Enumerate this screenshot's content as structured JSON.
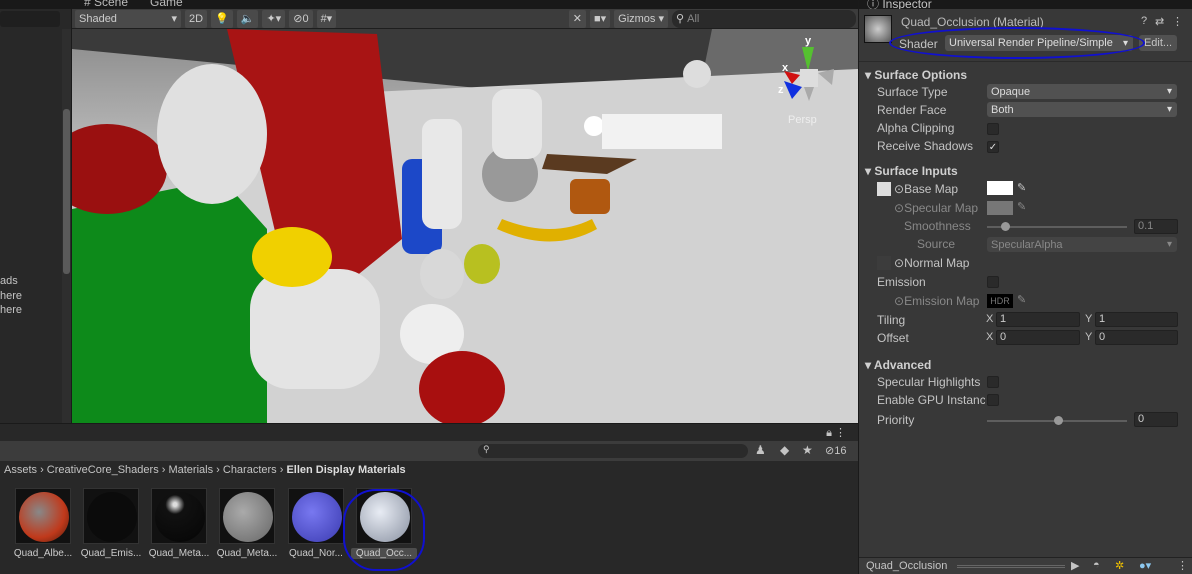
{
  "tabs": {
    "scene": "# Scene",
    "game": "Game"
  },
  "scene_toolbar": {
    "draw_mode": "Shaded",
    "two_d": "2D",
    "hidden_count": "0",
    "gizmos": "Gizmos",
    "search_placeholder": "All"
  },
  "hierarchy_fragments": [
    "ads",
    "here",
    "here"
  ],
  "viewport": {
    "axis_y": "y",
    "axis_x": "x",
    "axis_z": "z",
    "projection": "Persp"
  },
  "project": {
    "hidden_count": "16",
    "breadcrumb": [
      "Assets",
      "CreativeCore_Shaders",
      "Materials",
      "Characters",
      "Ellen Display Materials"
    ],
    "assets": [
      {
        "label": "Quad_Albe...",
        "color": "#c0391b"
      },
      {
        "label": "Quad_Emis...",
        "color": "#0b0b0b"
      },
      {
        "label": "Quad_Meta...",
        "color": "#1a1a1a"
      },
      {
        "label": "Quad_Meta...",
        "color": "#8a8a8a"
      },
      {
        "label": "Quad_Nor...",
        "color": "#5a5ad0"
      },
      {
        "label": "Quad_Occ...",
        "color": "#c8ccd8",
        "selected": true
      }
    ]
  },
  "inspector": {
    "tab": "Inspector",
    "title": "Quad_Occlusion (Material)",
    "shader_label": "Shader",
    "shader_value": "Universal Render Pipeline/Simple",
    "edit_button": "Edit...",
    "surface_options": {
      "header": "Surface Options",
      "surface_type_label": "Surface Type",
      "surface_type": "Opaque",
      "render_face_label": "Render Face",
      "render_face": "Both",
      "alpha_clipping": "Alpha Clipping",
      "receive_shadows": "Receive Shadows"
    },
    "surface_inputs": {
      "header": "Surface Inputs",
      "base_map": "Base Map",
      "specular_map": "Specular Map",
      "smoothness": "Smoothness",
      "smoothness_value": "0.1",
      "source_label": "Source",
      "source": "SpecularAlpha",
      "normal_map": "Normal Map",
      "emission": "Emission",
      "emission_map": "Emission Map",
      "hdr": "HDR",
      "tiling": "Tiling",
      "offset": "Offset",
      "x": "X",
      "y": "Y",
      "tiling_x": "1",
      "tiling_y": "1",
      "offset_x": "0",
      "offset_y": "0"
    },
    "advanced": {
      "header": "Advanced",
      "specular_highlights": "Specular Highlights",
      "gpu_instancing": "Enable GPU Instancir",
      "priority": "Priority",
      "priority_value": "0"
    },
    "footer": "Quad_Occlusion"
  },
  "annotation_color": "#1010d0"
}
